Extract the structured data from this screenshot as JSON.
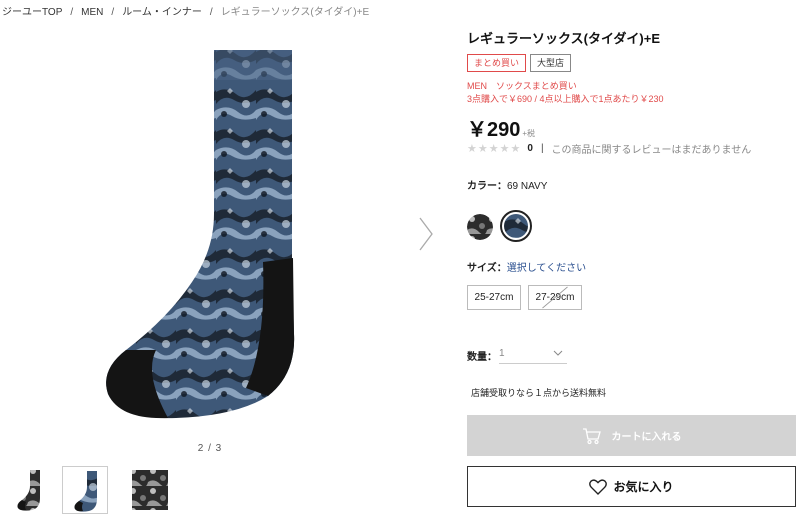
{
  "breadcrumb": {
    "items": [
      "ジーユーTOP",
      "MEN",
      "ルーム・インナー"
    ],
    "current": "レギュラーソックス(タイダイ)+E",
    "separator": "/"
  },
  "gallery": {
    "pager": "2 / 3",
    "thumbnails": [
      {
        "name": "sock-side-thumbnail",
        "active": false
      },
      {
        "name": "sock-navy-thumbnail",
        "active": true
      },
      {
        "name": "pattern-closeup-thumbnail",
        "active": false
      }
    ]
  },
  "product": {
    "title": "レギュラーソックス(タイダイ)+E",
    "badges": {
      "bundle": "まとめ買い",
      "large_store": "大型店"
    },
    "promo_line1": "MEN　ソックスまとめ買い",
    "promo_line2": "3点購入で￥690 / 4点以上購入で1点あたり￥230",
    "price": "￥290",
    "tax_label": "+税",
    "rating": {
      "stars": 5,
      "filled": 0,
      "count": "0",
      "separator": "|",
      "note": "この商品に関するレビューはまだありません"
    },
    "color": {
      "label": "カラー：",
      "value": "69 NAVY"
    },
    "size": {
      "label": "サイズ：",
      "hint": "選択してください",
      "options": [
        "25-27cm",
        "27-29cm"
      ]
    },
    "quantity": {
      "label": "数量：",
      "value": "1"
    },
    "shipping_note": "店舗受取りなら１点から送料無料",
    "cart_button": "カートに入れる",
    "favorite_button": "お気に入り"
  },
  "colors": {
    "accent_red": "#e04a4a",
    "link_blue": "#2a4f8f",
    "cart_disabled": "#d3d3d3",
    "sock_navy": "#3e5878",
    "sock_black": "#141414"
  },
  "icons": [
    "chevron-right-icon",
    "star-icon",
    "chevron-down-icon",
    "cart-icon",
    "heart-icon"
  ]
}
